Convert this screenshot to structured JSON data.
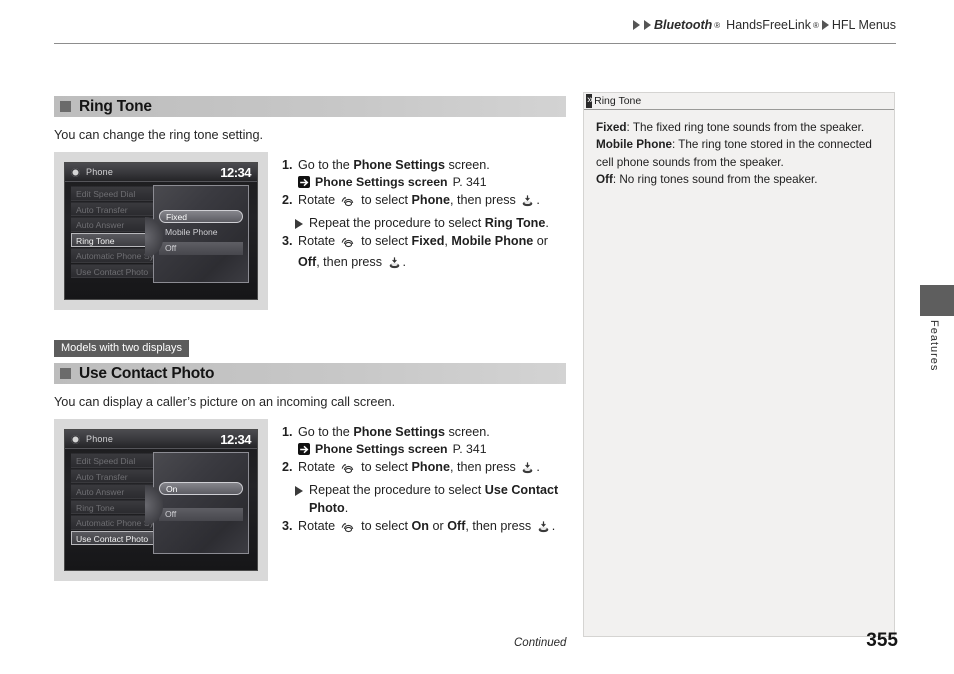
{
  "breadcrumb": {
    "item1": "Bluetooth",
    "sup1": "®",
    "item2": "HandsFreeLink",
    "sup2": "®",
    "item3": "HFL Menus"
  },
  "sections": [
    {
      "title": "Ring Tone",
      "lead": "You can change the ring tone setting.",
      "badge": null,
      "screen": {
        "header_title": "Phone",
        "clock": "12:34",
        "menu": [
          "Edit Speed Dial",
          "Auto Transfer",
          "Auto Answer",
          "Ring Tone",
          "Automatic Phone Sync",
          "Use Contact Photo"
        ],
        "menu_selected_index": 3,
        "popup_options": [
          "Fixed",
          "Mobile Phone",
          "Off"
        ],
        "popup_selected_index": 0
      },
      "steps": [
        {
          "number": "1.",
          "text_before": "Go to the ",
          "bold": "Phone Settings",
          "text_after": " screen."
        },
        {
          "number": "2.",
          "text_before": "Rotate ",
          "bold": "Phone",
          "text_after": ", then press "
        },
        {
          "number": "3.",
          "text_before": "Rotate ",
          "bold": "Fixed",
          "bold2": "Mobile Phone",
          "bold3": "Off",
          "text_after": ", then press "
        }
      ],
      "reference": {
        "label": "Phone Settings screen",
        "page": "P. 341"
      },
      "substep": {
        "text_before": "Repeat the procedure to select ",
        "bold": "Ring Tone",
        "text_after": "."
      },
      "step2_prefix": "Rotate ",
      "step2_mid": " to select ",
      "step3_mid": " to select ",
      "step3_sep1": ", ",
      "step3_sep2": " or ",
      "step3_tail": ", then press "
    },
    {
      "title": "Use Contact Photo",
      "lead": "You can display a caller’s picture on an incoming call screen.",
      "badge": "Models with two displays",
      "screen": {
        "header_title": "Phone",
        "clock": "12:34",
        "menu": [
          "Edit Speed Dial",
          "Auto Transfer",
          "Auto Answer",
          "Ring Tone",
          "Automatic Phone Sync",
          "Use Contact Photo"
        ],
        "menu_selected_index": 5,
        "popup_options": [
          "On",
          "Off"
        ],
        "popup_selected_index": 0
      },
      "reference": {
        "label": "Phone Settings screen",
        "page": "P. 341"
      },
      "substep": {
        "text_before": "Repeat the procedure to select ",
        "bold": "Use Contact Photo",
        "text_after": "."
      }
    }
  ],
  "step_text": {
    "go_to_the": "Go to the ",
    "phone_settings": "Phone Settings",
    "screen_suffix": " screen.",
    "rotate": "Rotate ",
    "to_select": " to select ",
    "then_press": ", then press ",
    "phone": "Phone",
    "period": ".",
    "comma": ", ",
    "or": " or ",
    "fixed": "Fixed",
    "mobile_phone": "Mobile Phone",
    "off": "Off",
    "on": "On",
    "repeat_procedure": "Repeat the procedure to select ",
    "ring_tone": "Ring Tone",
    "use_contact_photo": "Use Contact Photo",
    "n1": "1.",
    "n2": "2.",
    "n3": "3."
  },
  "note": {
    "icon": "double-chevron-icon",
    "title": "Ring Tone",
    "lines": [
      {
        "bold": "Fixed",
        "text": ": The fixed ring tone sounds from the speaker."
      },
      {
        "bold": "Mobile Phone",
        "text": ": The ring tone stored in the connected cell phone sounds from the speaker."
      },
      {
        "bold": "Off",
        "text": ": No ring tones sound from the speaker."
      }
    ]
  },
  "side_tab": {
    "label": "Features"
  },
  "footer": {
    "continued": "Continued",
    "page_number": "355"
  },
  "colors": {
    "heading_bar": "#c7c7c7",
    "heading_square": "#6b6b6b",
    "badge_bg": "#5c5c5c",
    "note_bg": "#f2f1f0",
    "figure_bg": "#d9d9d9",
    "tab_block": "#5e5e5e"
  }
}
